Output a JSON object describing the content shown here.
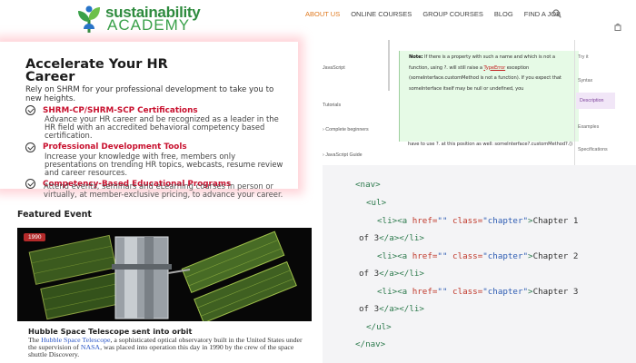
{
  "header": {
    "logo_line1": "sustainability",
    "logo_line2": "ACADEMY",
    "nav": [
      "ABOUT US",
      "ONLINE COURSES",
      "GROUP COURSES",
      "BLOG",
      "FIND A JOB"
    ],
    "active_nav": "ABOUT US",
    "accent_color": "#e07a20"
  },
  "hr_card": {
    "title_l1": "Accelerate Your HR",
    "title_l2": "Career",
    "intro": "Rely on SHRM for your professional development to take you to new heights.",
    "items": [
      {
        "title": "SHRM-CP/SHRM-SCP Certifications",
        "desc": "Advance your HR career and be recognized as a leader in the HR field with an accredited behavioral competency based certification."
      },
      {
        "title": "Professional Development Tools",
        "desc": "Increase your knowledge with free, members only presentations on trending HR topics, webcasts, resume review and career resources."
      },
      {
        "title": "Competency-Based Educational Programs",
        "desc": "Attend events, seminars and eLearning courses in person or virtually, at member-exclusive pricing, to advance your career."
      }
    ]
  },
  "featured": {
    "heading": "Featured Event",
    "badge": "1990",
    "caption_title": "Hubble Space Telescope sent into orbit",
    "desc_pre": "The ",
    "desc_link1": "Hubble Space Telescope",
    "desc_mid": ", a sophisticated optical observatory built in the United States under the supervision of ",
    "desc_link2": "NASA",
    "desc_post": ", was placed into operation this day in 1990 by the crew of the space shuttle Discovery."
  },
  "docs": {
    "side_items": [
      "JavaScript",
      "Tutorials",
      "Complete beginners",
      "JavaScript Guide"
    ],
    "note_label": "Note:",
    "note_text1": " If there is a property with such a name and which is not a function, using ",
    "note_code1": "?.",
    "note_text2": " will still raise a ",
    "note_red": "TypeError",
    "note_text3": " exception (",
    "note_code2": "someInterface.customMethod is not a function",
    "note_text4": "). If you expect that someInterface itself may be null or undefined, you",
    "note_tail": "have to use ?. at this position as well: someInterface?.customMethod?.()",
    "right_items": [
      "Try it",
      "Syntax",
      "Description",
      "Examples",
      "Specifications"
    ],
    "right_active": "Description"
  },
  "code": {
    "lines": [
      {
        "indent": "  ",
        "parts": [
          [
            "tag",
            "<nav>"
          ]
        ]
      },
      {
        "indent": "    ",
        "parts": [
          [
            "tag",
            "<ul>"
          ]
        ]
      },
      {
        "indent": "      ",
        "parts": [
          [
            "tag",
            "<li><a "
          ],
          [
            "attr",
            "href="
          ],
          [
            "str",
            "\"\""
          ],
          [
            "txt",
            " "
          ],
          [
            "attr",
            "class="
          ],
          [
            "str",
            "\"chapter\""
          ],
          [
            "tag",
            ">"
          ],
          [
            "txt",
            "Chapter 1"
          ]
        ]
      },
      {
        "indent": "",
        "parts": [
          [
            "txt",
            "of 3"
          ],
          [
            "tag",
            "</a></li>"
          ]
        ]
      },
      {
        "indent": "      ",
        "parts": [
          [
            "tag",
            "<li><a "
          ],
          [
            "attr",
            "href="
          ],
          [
            "str",
            "\"\""
          ],
          [
            "txt",
            " "
          ],
          [
            "attr",
            "class="
          ],
          [
            "str",
            "\"chapter\""
          ],
          [
            "tag",
            ">"
          ],
          [
            "txt",
            "Chapter 2"
          ]
        ]
      },
      {
        "indent": "",
        "parts": [
          [
            "txt",
            "of 3"
          ],
          [
            "tag",
            "</a></li>"
          ]
        ]
      },
      {
        "indent": "      ",
        "parts": [
          [
            "tag",
            "<li><a "
          ],
          [
            "attr",
            "href="
          ],
          [
            "str",
            "\"\""
          ],
          [
            "txt",
            " "
          ],
          [
            "attr",
            "class="
          ],
          [
            "str",
            "\"chapter\""
          ],
          [
            "tag",
            ">"
          ],
          [
            "txt",
            "Chapter 3"
          ]
        ]
      },
      {
        "indent": "",
        "parts": [
          [
            "txt",
            "of 3"
          ],
          [
            "tag",
            "</a></li>"
          ]
        ]
      },
      {
        "indent": "    ",
        "parts": [
          [
            "tag",
            "</ul>"
          ]
        ]
      },
      {
        "indent": "  ",
        "parts": [
          [
            "tag",
            "</nav>"
          ]
        ]
      }
    ]
  }
}
